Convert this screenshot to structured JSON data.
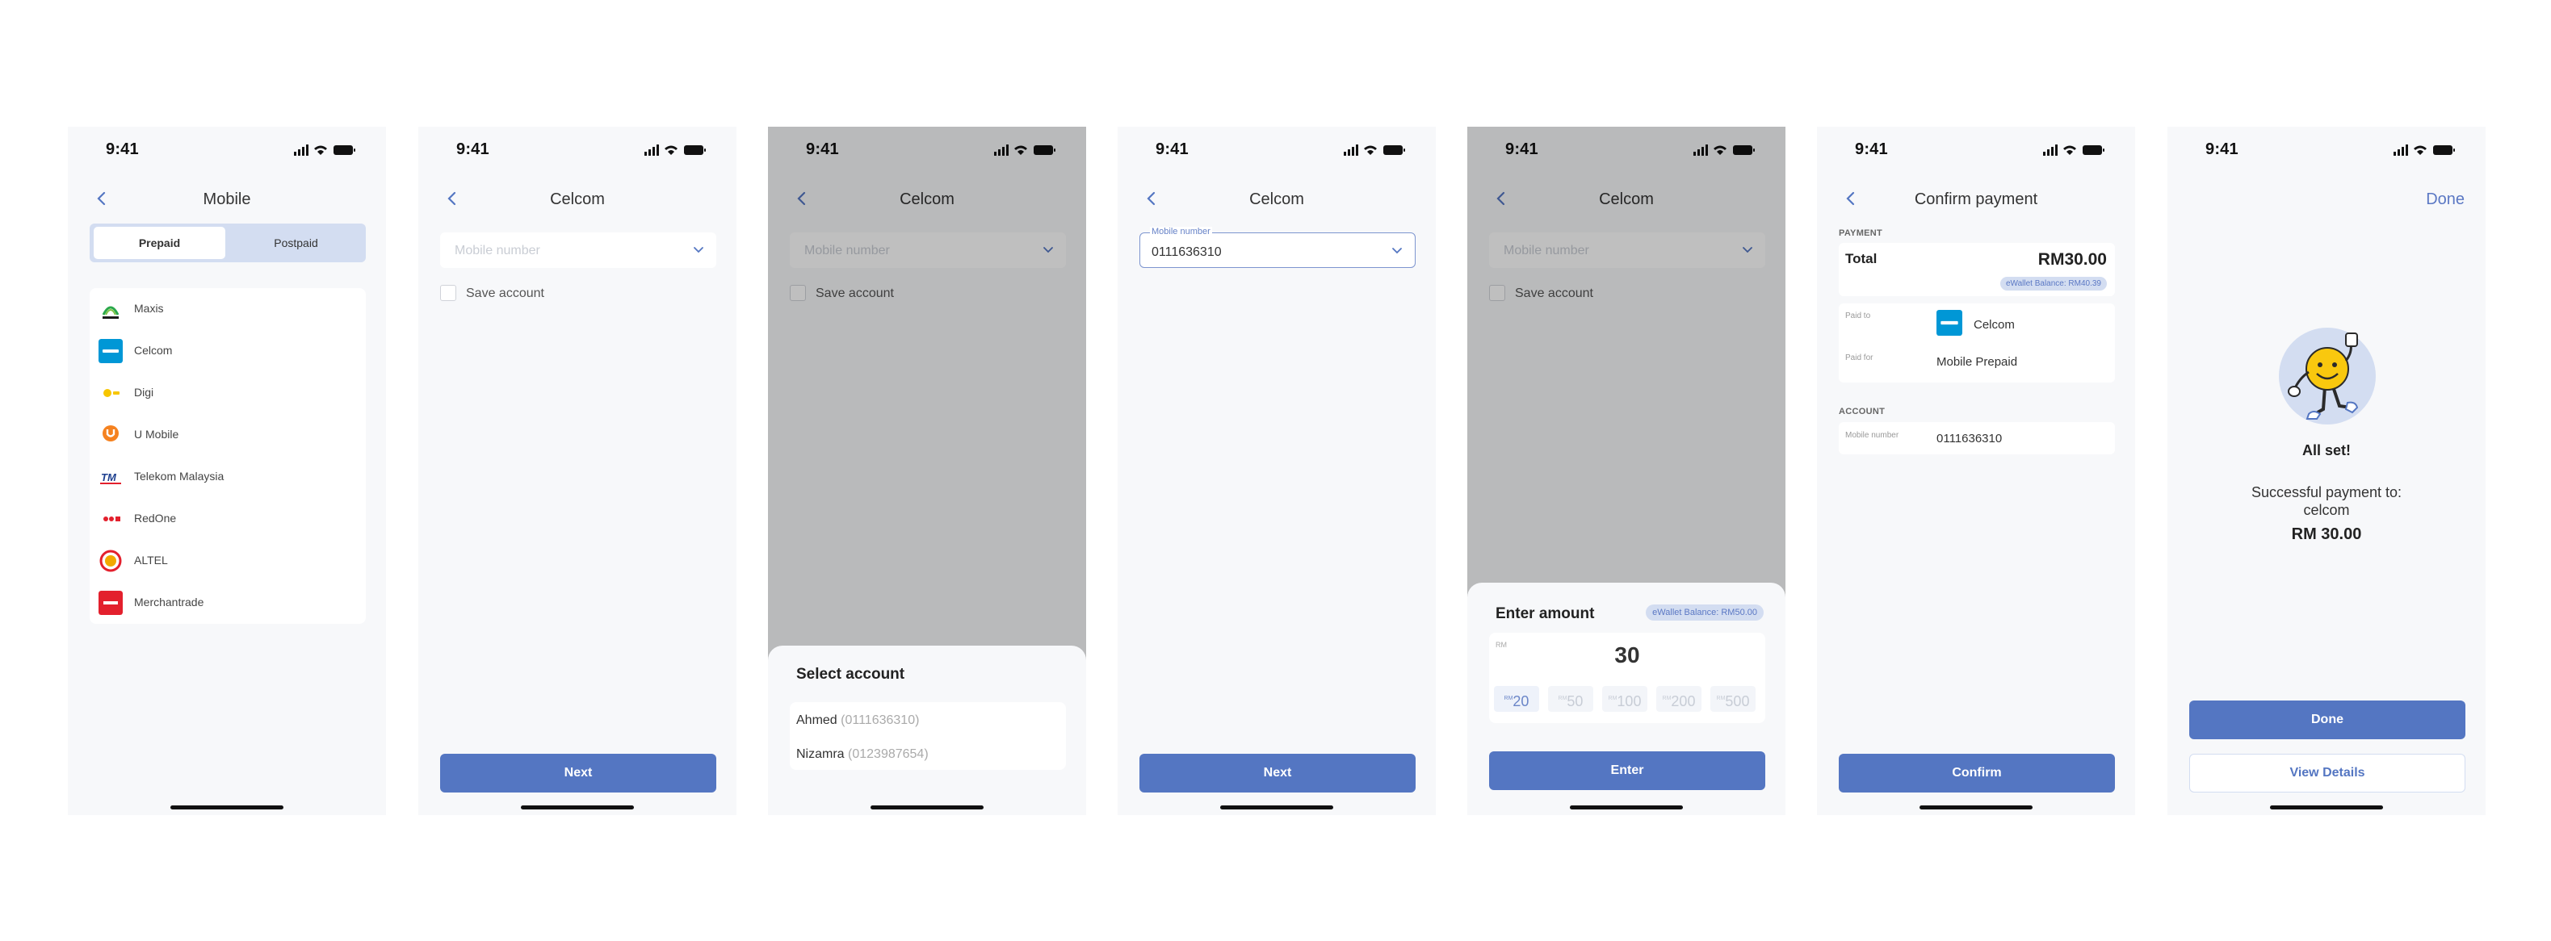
{
  "status": {
    "time": "9:41"
  },
  "screen1": {
    "title": "Mobile",
    "tabs": [
      "Prepaid",
      "Postpaid"
    ],
    "providers": [
      "Maxis",
      "Celcom",
      "Digi",
      "U Mobile",
      "Telekom Malaysia",
      "RedOne",
      "ALTEL",
      "Merchantrade"
    ]
  },
  "screen2": {
    "title": "Celcom",
    "mobile_placeholder": "Mobile number",
    "save_account": "Save account",
    "next": "Next"
  },
  "screen3": {
    "title": "Celcom",
    "mobile_placeholder": "Mobile number",
    "save_account": "Save account",
    "sheet_title": "Select account",
    "accounts": [
      {
        "name": "Ahmed",
        "number": "(0111636310)"
      },
      {
        "name": "Nizamra",
        "number": "(0123987654)"
      }
    ]
  },
  "screen4": {
    "title": "Celcom",
    "field_label": "Mobile number",
    "mobile_value": "0111636310",
    "next": "Next"
  },
  "screen5": {
    "title": "Celcom",
    "mobile_placeholder": "Mobile number",
    "save_account": "Save account",
    "sheet_title": "Enter amount",
    "balance_badge": "eWallet Balance: RM50.00",
    "currency": "RM",
    "amount": "30",
    "chips": [
      {
        "cur": "RM",
        "val": "20"
      },
      {
        "cur": "RM",
        "val": "50"
      },
      {
        "cur": "RM",
        "val": "100"
      },
      {
        "cur": "RM",
        "val": "200"
      },
      {
        "cur": "RM",
        "val": "500"
      }
    ],
    "enter": "Enter"
  },
  "screen6": {
    "title": "Confirm payment",
    "payment_label": "PAYMENT",
    "total_label": "Total",
    "total_value": "RM30.00",
    "balance_badge": "eWallet Balance: RM40.39",
    "paid_to_label": "Paid to",
    "paid_to_value": "Celcom",
    "paid_for_label": "Paid for",
    "paid_for_value": "Mobile Prepaid",
    "account_label": "ACCOUNT",
    "mobile_label": "Mobile number",
    "mobile_value": "0111636310",
    "confirm": "Confirm"
  },
  "screen7": {
    "done_link": "Done",
    "title": "All set!",
    "line1": "Successful payment to:",
    "line2": "celcom",
    "amount": "RM 30.00",
    "done_button": "Done",
    "details_button": "View Details"
  },
  "colors": {
    "primary": "#5476c2",
    "accent_light": "#d3ddf1",
    "background": "#f7f8fa",
    "overlay": "#bebfc1"
  }
}
